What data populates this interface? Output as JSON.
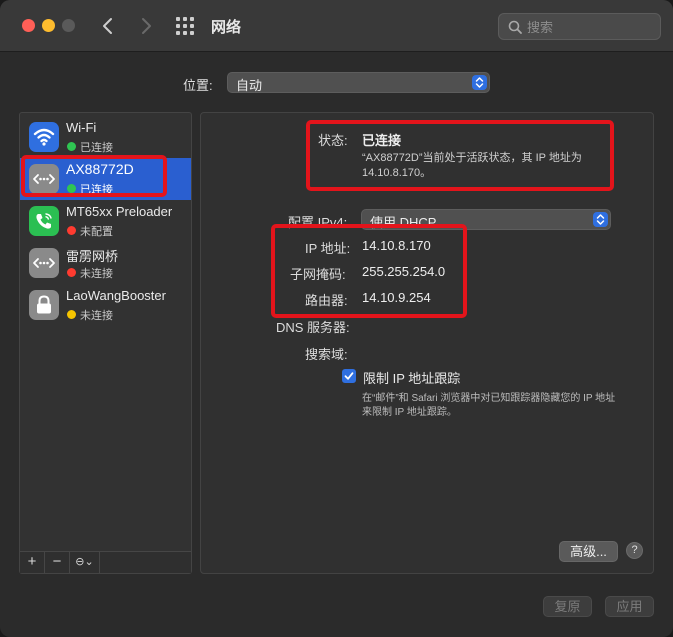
{
  "window": {
    "title": "网络",
    "search_placeholder": "搜索"
  },
  "location": {
    "label": "位置:",
    "value": "自动"
  },
  "services": [
    {
      "name": "Wi-Fi",
      "status": "已连接",
      "status_color": "#2fc552",
      "icon": "wifi-icon",
      "icon_bg": "#2f6fe0"
    },
    {
      "name": "AX88772D",
      "status": "已连接",
      "status_color": "#2fc552",
      "icon": "ethernet-icon",
      "icon_bg": "#8a8a8a",
      "selected": true
    },
    {
      "name": "MT65xx Preloader",
      "status": "未配置",
      "status_color": "#ff3b30",
      "icon": "phone-icon",
      "icon_bg": "#2bbf52"
    },
    {
      "name": "雷雳网桥",
      "status": "未连接",
      "status_color": "#ff3b30",
      "icon": "ethernet-icon",
      "icon_bg": "#8a8a8a"
    },
    {
      "name": "LaoWangBooster",
      "status": "未连接",
      "status_color": "#f5c400",
      "icon": "lock-icon",
      "icon_bg": "#8a8a8a"
    }
  ],
  "sidebar_toolbar": {
    "add": "+",
    "remove": "−",
    "action": "⊖⌄"
  },
  "detail": {
    "status_label": "状态:",
    "status_value": "已连接",
    "status_desc": "“AX88772D”当前处于活跃状态，其 IP 地址为 14.10.8.170。",
    "config_label": "配置 IPv4:",
    "config_value": "使用 DHCP",
    "ip_label": "IP 地址:",
    "ip_value": "14.10.8.170",
    "mask_label": "子网掩码:",
    "mask_value": "255.255.254.0",
    "router_label": "路由器:",
    "router_value": "14.10.9.254",
    "dns_label": "DNS 服务器:",
    "search_domain_label": "搜索域:",
    "limit_ip_label": "限制 IP 地址跟踪",
    "limit_ip_checked": true,
    "limit_ip_note": "在“邮件”和 Safari 浏览器中对已知跟踪器隐藏您的 IP 地址来限制 IP 地址跟踪。"
  },
  "buttons": {
    "advanced": "高级...",
    "help": "?",
    "revert": "复原",
    "apply": "应用"
  },
  "colors": {
    "accent": "#2f6fe0",
    "highlight_box": "#e3141b"
  }
}
